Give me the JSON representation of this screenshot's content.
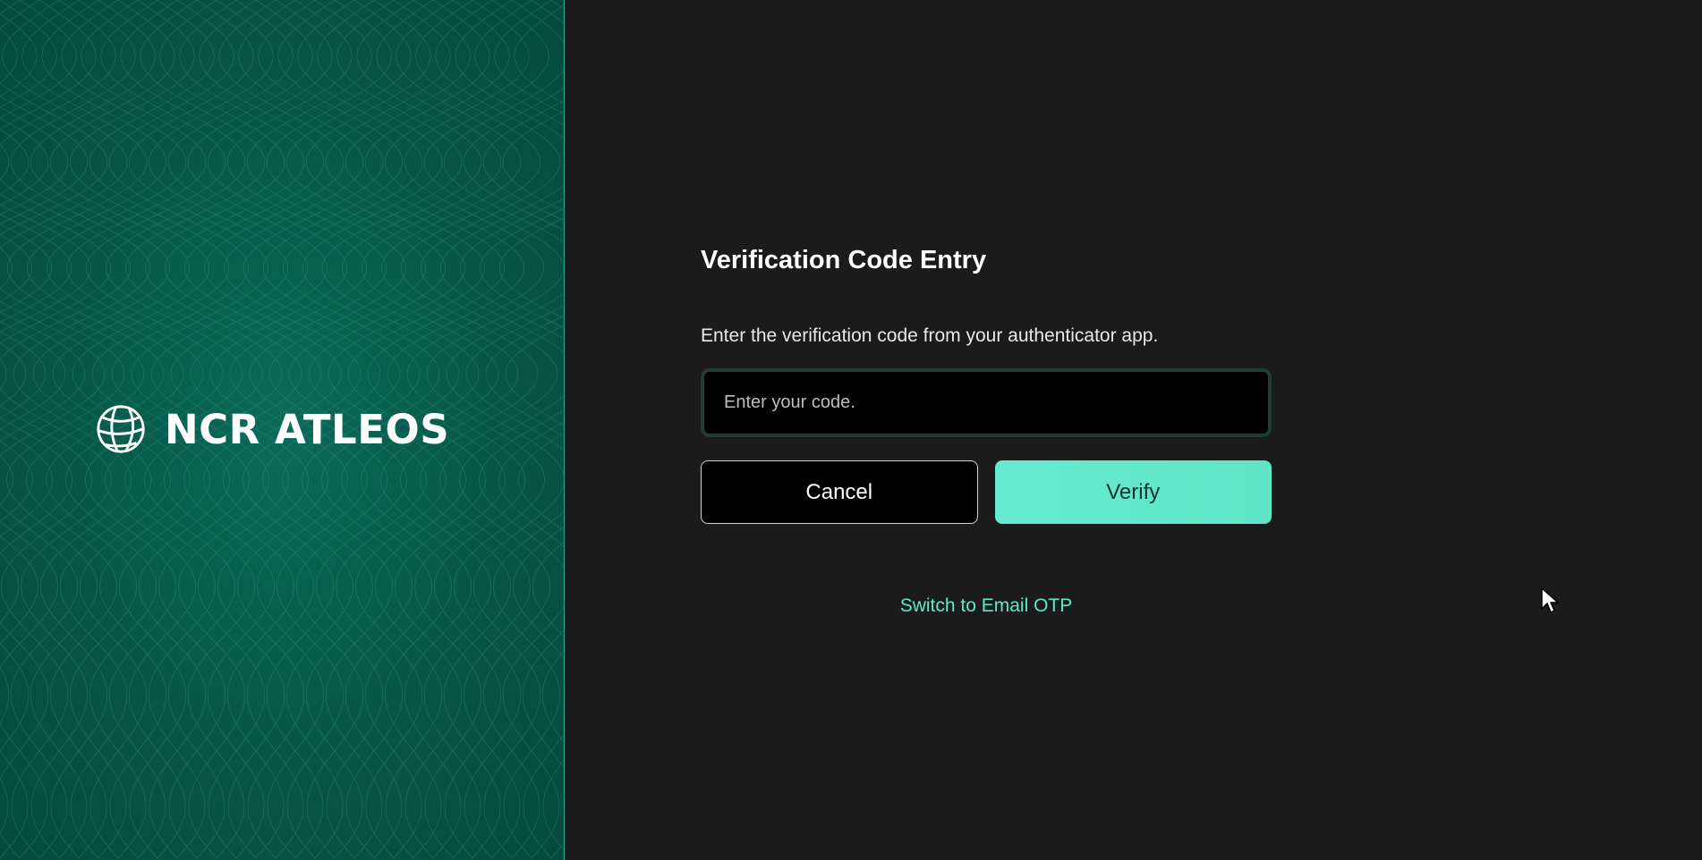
{
  "brand": {
    "name": "NCR ATLEOS",
    "logo_icon": "globe-icon",
    "panel_color": "#075646",
    "accent_line_color": "#2aa58a"
  },
  "form": {
    "title": "Verification Code Entry",
    "instruction": "Enter the verification code from your authenticator app.",
    "code_input": {
      "value": "",
      "placeholder": "Enter your code."
    },
    "cancel_label": "Cancel",
    "verify_label": "Verify",
    "switch_link_label": "Switch to Email OTP"
  },
  "colors": {
    "background": "#1b1b1b",
    "accent": "#5fe8c8",
    "input_background": "#000000"
  },
  "pointer": {
    "icon": "mouse-pointer-icon"
  }
}
